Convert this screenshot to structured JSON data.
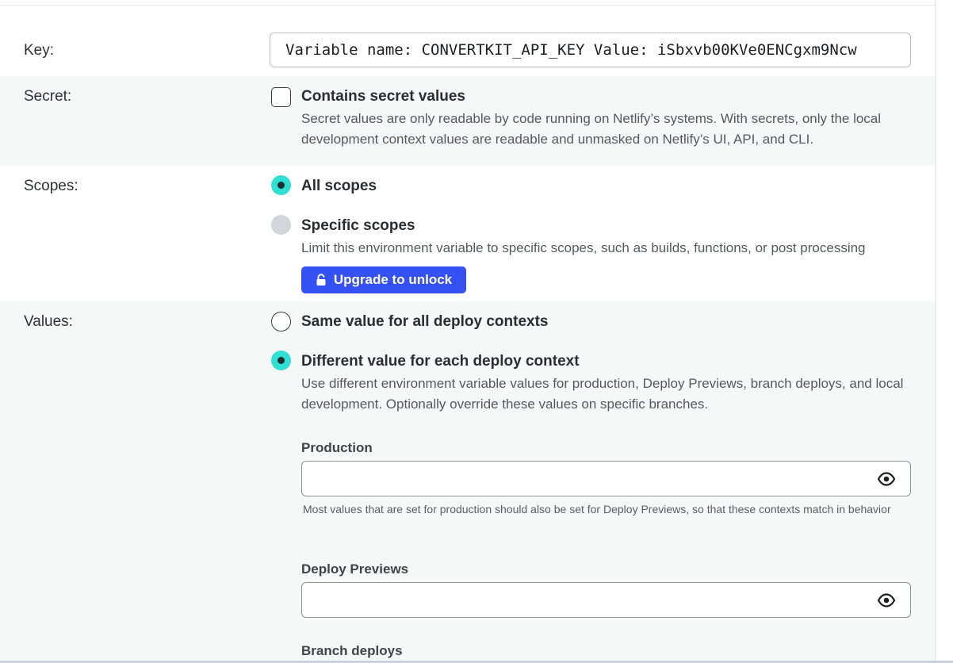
{
  "key": {
    "label": "Key:",
    "value": "Variable name: CONVERTKIT_API_KEY Value: iSbxvb00KVe0ENCgxm9Ncw"
  },
  "secret": {
    "label": "Secret:",
    "checkbox_label": "Contains secret values",
    "checked": false,
    "description": "Secret values are only readable by code running on Netlify’s systems. With secrets, only the local development context values are readable and unmasked on Netlify’s UI, API, and CLI."
  },
  "scopes": {
    "label": "Scopes:",
    "options": [
      {
        "label": "All scopes",
        "selected": true
      },
      {
        "label": "Specific scopes",
        "selected": false,
        "description": "Limit this environment variable to specific scopes, such as builds, functions, or post processing"
      }
    ],
    "upgrade_button": "Upgrade to unlock"
  },
  "values": {
    "label": "Values:",
    "options": [
      {
        "label": "Same value for all deploy contexts",
        "selected": false
      },
      {
        "label": "Different value for each deploy context",
        "selected": true,
        "description": "Use different environment variable values for production, Deploy Previews, branch deploys, and local development. Optionally override these values on specific branches."
      }
    ],
    "fields": [
      {
        "label": "Production",
        "value": "",
        "help": "Most values that are set for production should also be set for Deploy Previews, so that these contexts match in behavior"
      },
      {
        "label": "Deploy Previews",
        "value": ""
      },
      {
        "label": "Branch deploys",
        "value": ""
      }
    ]
  },
  "colors": {
    "accent_radio": "#30dfd3",
    "button": "#3550f3",
    "band_gray": "#f6f8f8"
  },
  "icons": {
    "lock": "lock-icon",
    "eye": "eye-icon"
  }
}
